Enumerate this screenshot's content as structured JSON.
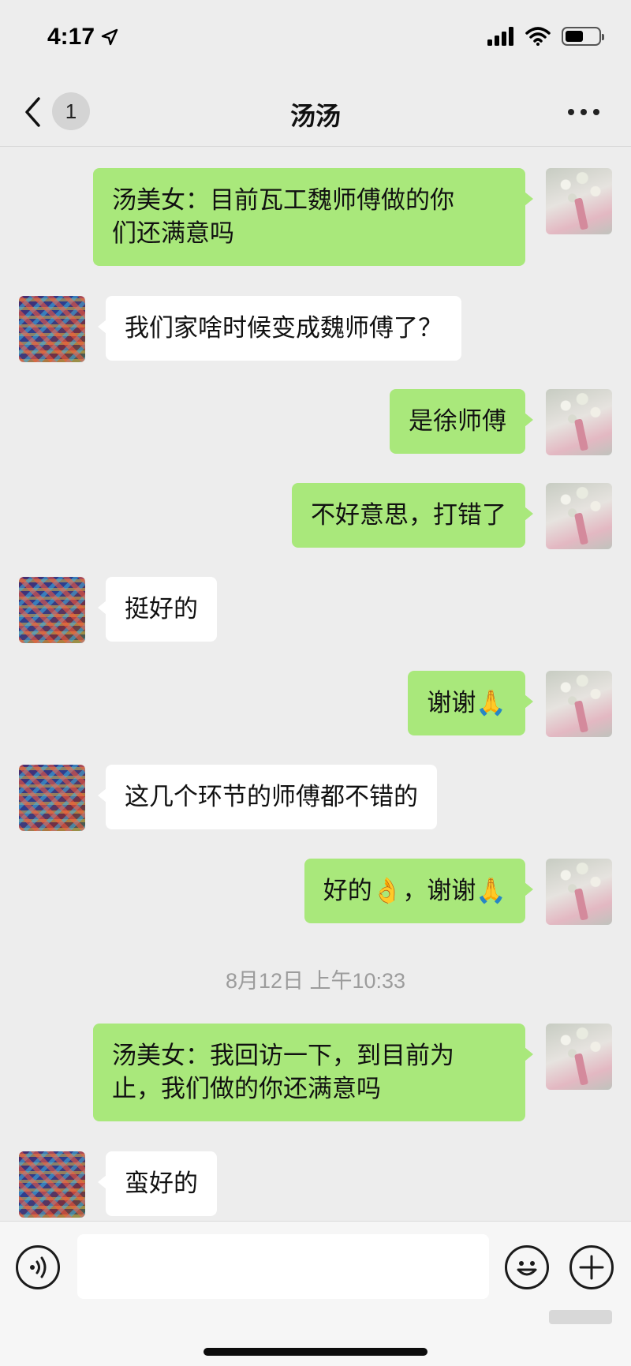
{
  "status_bar": {
    "time": "4:17"
  },
  "header": {
    "back_badge": "1",
    "title": "汤汤"
  },
  "messages": [
    {
      "sender": "self",
      "text": "汤美女：目前瓦工魏师傅做的你\n们还满意吗"
    },
    {
      "sender": "other",
      "text": "我们家啥时候变成魏师傅了？"
    },
    {
      "sender": "self",
      "text": "是徐师傅"
    },
    {
      "sender": "self",
      "text": "不好意思，打错了"
    },
    {
      "sender": "other",
      "text": "挺好的"
    },
    {
      "sender": "self",
      "text": "谢谢🙏"
    },
    {
      "sender": "other",
      "text": "这几个环节的师傅都不错的"
    },
    {
      "sender": "self",
      "text": "好的👌，谢谢🙏"
    },
    {
      "sender": "self",
      "text": "汤美女：我回访一下，到目前为\n止，我们做的你还满意吗"
    },
    {
      "sender": "other",
      "text": "蛮好的"
    }
  ],
  "timestamp": "8月12日 上午10:33",
  "input_bar": {
    "text": "",
    "placeholder": ""
  },
  "colors": {
    "self_bubble": "#a9e87b",
    "other_bubble": "#ffffff",
    "background": "#ededed"
  }
}
